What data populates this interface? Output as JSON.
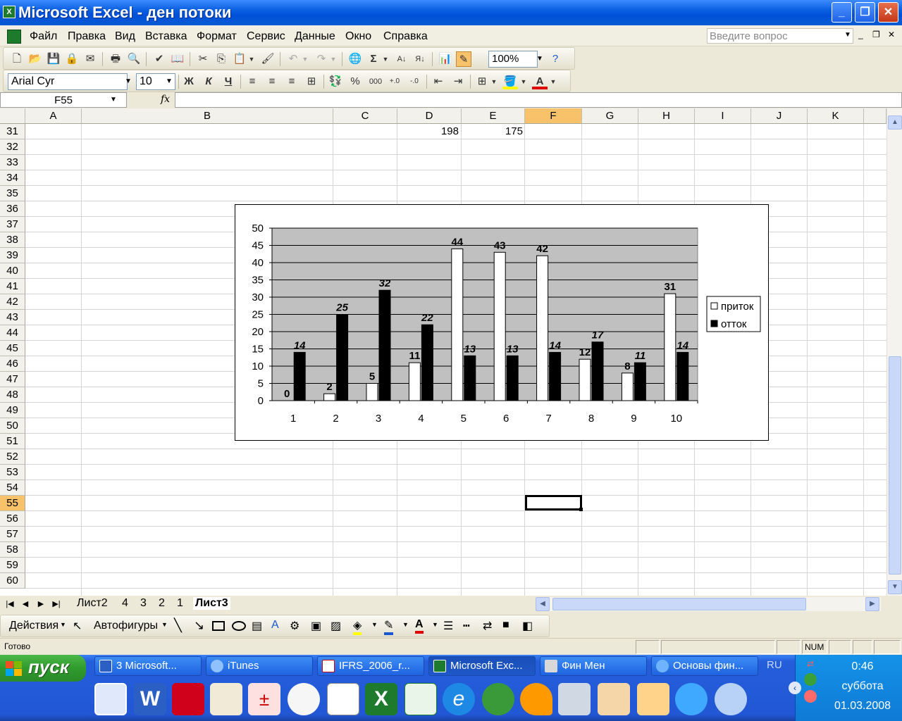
{
  "window": {
    "title": "Microsoft Excel - ден потоки",
    "min": "_",
    "max": "❐",
    "close": "✕"
  },
  "menu": {
    "items": [
      "Файл",
      "Правка",
      "Вид",
      "Вставка",
      "Формат",
      "Сервис",
      "Данные",
      "Окно",
      "Справка"
    ],
    "ask_placeholder": "Введите вопрос"
  },
  "toolbar": {
    "zoom": "100%",
    "font": "Arial Cyr",
    "size": "10",
    "bold": "Ж",
    "italic": "К",
    "underline": "Ч",
    "percent": "%",
    "thousands": "000"
  },
  "formula": {
    "name_box": "F55",
    "fx": "fx",
    "content": ""
  },
  "columns": [
    "A",
    "B",
    "C",
    "D",
    "E",
    "F",
    "G",
    "H",
    "I",
    "J",
    "K"
  ],
  "rows": [
    "31",
    "32",
    "33",
    "34",
    "35",
    "36",
    "37",
    "38",
    "39",
    "40",
    "41",
    "42",
    "43",
    "44",
    "45",
    "46",
    "47",
    "48",
    "49",
    "50",
    "51",
    "52",
    "53",
    "54",
    "55",
    "56",
    "57",
    "58",
    "59",
    "60"
  ],
  "cells": {
    "D31": "198",
    "E31": "175"
  },
  "chart_data": {
    "type": "bar",
    "categories": [
      "1",
      "2",
      "3",
      "4",
      "5",
      "6",
      "7",
      "8",
      "9",
      "10"
    ],
    "series": [
      {
        "name": "приток",
        "values": [
          0,
          2,
          5,
          11,
          44,
          43,
          42,
          12,
          8,
          31
        ],
        "color": "#ffffff"
      },
      {
        "name": "отток",
        "values": [
          14,
          25,
          32,
          22,
          13,
          13,
          14,
          17,
          11,
          14
        ],
        "color": "#000000"
      }
    ],
    "ylim": [
      0,
      50
    ],
    "yticks": [
      0,
      5,
      10,
      15,
      20,
      25,
      30,
      35,
      40,
      45,
      50
    ],
    "plot_background": "#c0c0c0",
    "grid": true,
    "legend": "right"
  },
  "sheets": {
    "tabs": [
      "Лист2",
      "4",
      "3",
      "2",
      "1",
      "Лист3"
    ],
    "active": "Лист3"
  },
  "drawing": {
    "actions": "Действия",
    "autoshapes": "Автофигуры"
  },
  "status": {
    "ready": "Готово",
    "num": "NUM"
  },
  "taskbar": {
    "start": "пуск",
    "buttons": [
      "3 Microsoft...",
      "iTunes",
      "IFRS_2006_r...",
      "Microsoft Exc...",
      "Фин Мен",
      "Основы фин..."
    ],
    "lang": "RU",
    "time": "0:46",
    "day": "суббота",
    "date": "01.03.2008"
  }
}
